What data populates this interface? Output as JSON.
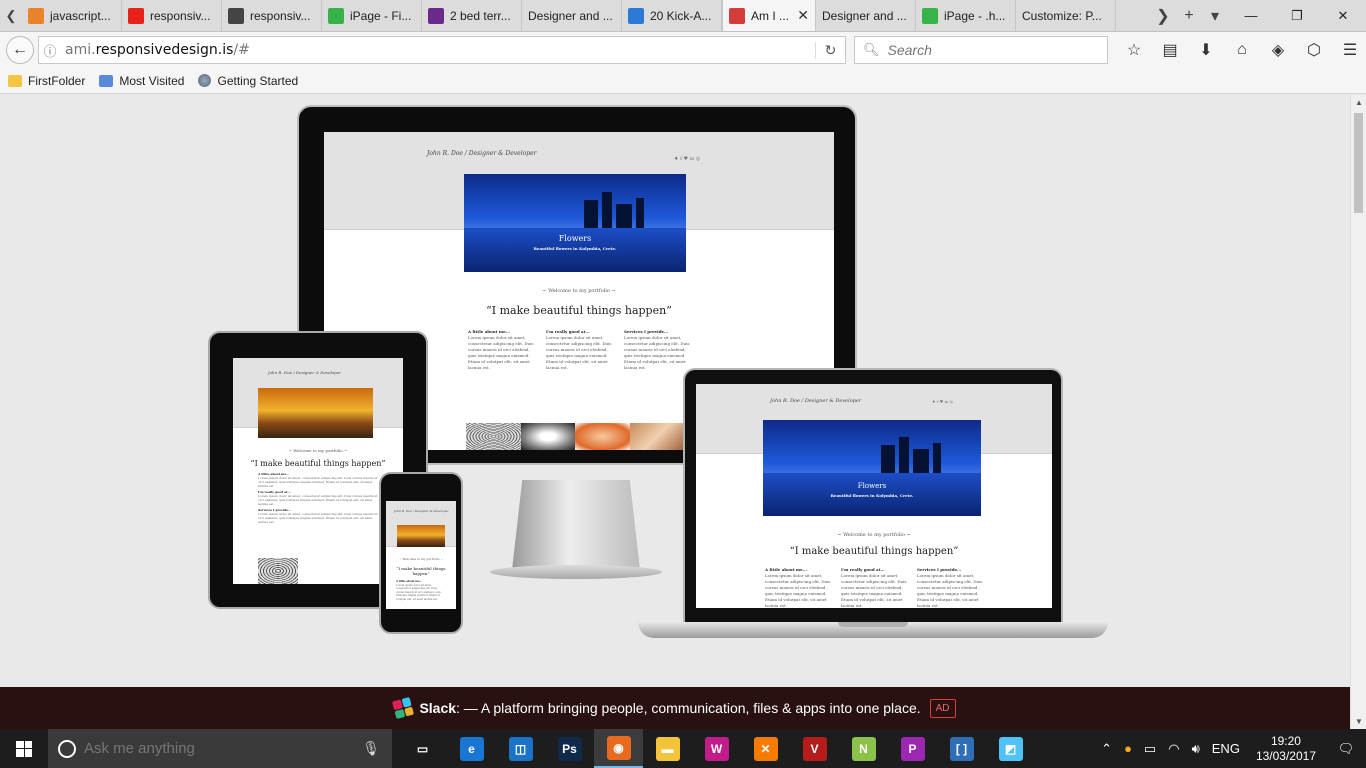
{
  "tabs": [
    {
      "label": "javascript...",
      "favicon_color": "#e8832a",
      "icon": "stack-icon"
    },
    {
      "label": "responsiv...",
      "favicon_color": "#e62117",
      "icon": "youtube-icon"
    },
    {
      "label": "responsiv...",
      "favicon_color": "#444444",
      "icon": "grid-icon"
    },
    {
      "label": "iPage - Fi...",
      "favicon_color": "#38b34a",
      "icon": "ipage-icon"
    },
    {
      "label": "2 bed terr...",
      "favicon_color": "#6b2a8a",
      "icon": "zoopla-icon"
    },
    {
      "label": "Designer and ...",
      "favicon_color": "",
      "icon": ""
    },
    {
      "label": "20 Kick-A...",
      "favicon_color": "#2a7ad6",
      "icon": "fish-icon"
    },
    {
      "label": "Am I ...",
      "favicon_color": "#d63b3b",
      "icon": "amiresponsive-icon",
      "active": true
    },
    {
      "label": "Designer and ...",
      "favicon_color": "",
      "icon": ""
    },
    {
      "label": "iPage - .h...",
      "favicon_color": "#38b34a",
      "icon": "ipage-icon"
    },
    {
      "label": "Customize: P...",
      "favicon_color": "",
      "icon": ""
    }
  ],
  "url": {
    "prefix": "ami.",
    "domain": "responsivedesign.is",
    "suffix": "/#"
  },
  "search": {
    "placeholder": "Search"
  },
  "bookmarks": [
    {
      "label": "FirstFolder",
      "icon": "folder-icon"
    },
    {
      "label": "Most Visited",
      "icon": "most-visited-icon"
    },
    {
      "label": "Getting Started",
      "icon": "globe-icon"
    }
  ],
  "site": {
    "author": "John R. Doe / Designer & Developer",
    "slide_title": "Flowers",
    "slide_sub": "Beautiful flowers in Kolymbia, Crete.",
    "welcome": "~ Welcome to my portfolio ~",
    "quote": "“I make beautiful things happen”",
    "cols": [
      {
        "title": "A little about me...",
        "body": "Lorem ipsum dolor sit amet, consectetur adipiscing elit. Duis cursus mauris id orci eleifend, quis tristique magna euismod. Etiam id volutpat elit, sit amet lacinia est."
      },
      {
        "title": "I'm really good at...",
        "body": "Lorem ipsum dolor sit amet, consectetur adipiscing elit. Duis cursus mauris id orci eleifend, quis tristique magna euismod. Etiam id volutpat elit, sit amet lacinia est."
      },
      {
        "title": "Services I provide...",
        "body": "Lorem ipsum dolor sit amet, consectetur adipiscing elit. Duis cursus mauris id orci eleifend, quis tristique magna euismod. Etiam id volutpat elit, sit amet lacinia est."
      }
    ]
  },
  "ad": {
    "brand": "Slack",
    "text": ": — A platform bringing people, communication, files & apps into one place.",
    "tag": "AD"
  },
  "taskbar": {
    "search_placeholder": "Ask me anything",
    "apps": [
      {
        "name": "task-view-icon",
        "color": "#1d1d1d",
        "glyph": "▭"
      },
      {
        "name": "edge-icon",
        "color": "#1976d2",
        "glyph": "e"
      },
      {
        "name": "store-icon",
        "color": "#1a73c8",
        "glyph": "◫"
      },
      {
        "name": "photoshop-icon",
        "color": "#0f2a4a",
        "glyph": "Ps"
      },
      {
        "name": "firefox-icon",
        "color": "#e86a1e",
        "glyph": "◉",
        "active": true
      },
      {
        "name": "explorer-icon",
        "color": "#f3c33a",
        "glyph": "▬"
      },
      {
        "name": "wamp-icon",
        "color": "#c21b8a",
        "glyph": "W"
      },
      {
        "name": "xampp-icon",
        "color": "#f57c00",
        "glyph": "✕"
      },
      {
        "name": "vbox-icon",
        "color": "#b71c1c",
        "glyph": "V"
      },
      {
        "name": "notepad-icon",
        "color": "#8bc34a",
        "glyph": "N"
      },
      {
        "name": "paint-icon",
        "color": "#9c27b0",
        "glyph": "P"
      },
      {
        "name": "vm-icon",
        "color": "#2f6fb8",
        "glyph": "[ ]"
      },
      {
        "name": "sticky-icon",
        "color": "#4fc3f7",
        "glyph": "◩"
      }
    ],
    "lang": "ENG",
    "time": "19:20",
    "date": "13/03/2017"
  }
}
